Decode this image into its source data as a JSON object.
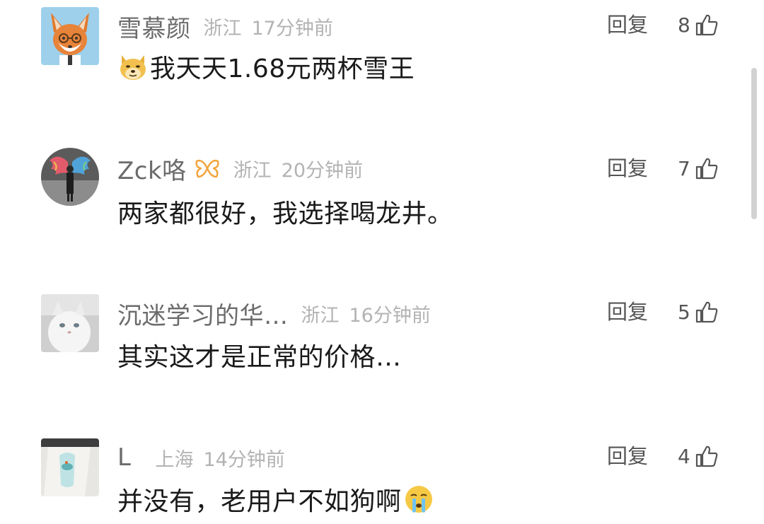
{
  "comments": [
    {
      "username": "雪慕颜",
      "location": "浙江",
      "time": "17分钟前",
      "reply_label": "回复",
      "likes": "8",
      "lead_emoji": "doge-emoji",
      "text": "我天天1.68元两杯雪王"
    },
    {
      "username": "Zck咯",
      "location": "浙江",
      "time": "20分钟前",
      "reply_label": "回复",
      "likes": "7",
      "text": "两家都很好，我选择喝龙井。"
    },
    {
      "username": "沉迷学习的华…",
      "location": "浙江",
      "time": "16分钟前",
      "reply_label": "回复",
      "likes": "5",
      "text": "其实这才是正常的价格…"
    },
    {
      "username": "L",
      "location": "上海",
      "time": "14分钟前",
      "reply_label": "回复",
      "likes": "4",
      "text": "并没有，老用户不如狗啊",
      "trail_emoji": "crying-emoji"
    }
  ],
  "icons": {
    "like": "thumbs-up-icon",
    "vip_badge": "butterfly-vip-icon"
  },
  "colors": {
    "username": "#6b6b6b",
    "meta": "#b3b3b3",
    "text": "#1a1a1a",
    "action": "#555555",
    "vip_badge": "#f2a33a"
  }
}
